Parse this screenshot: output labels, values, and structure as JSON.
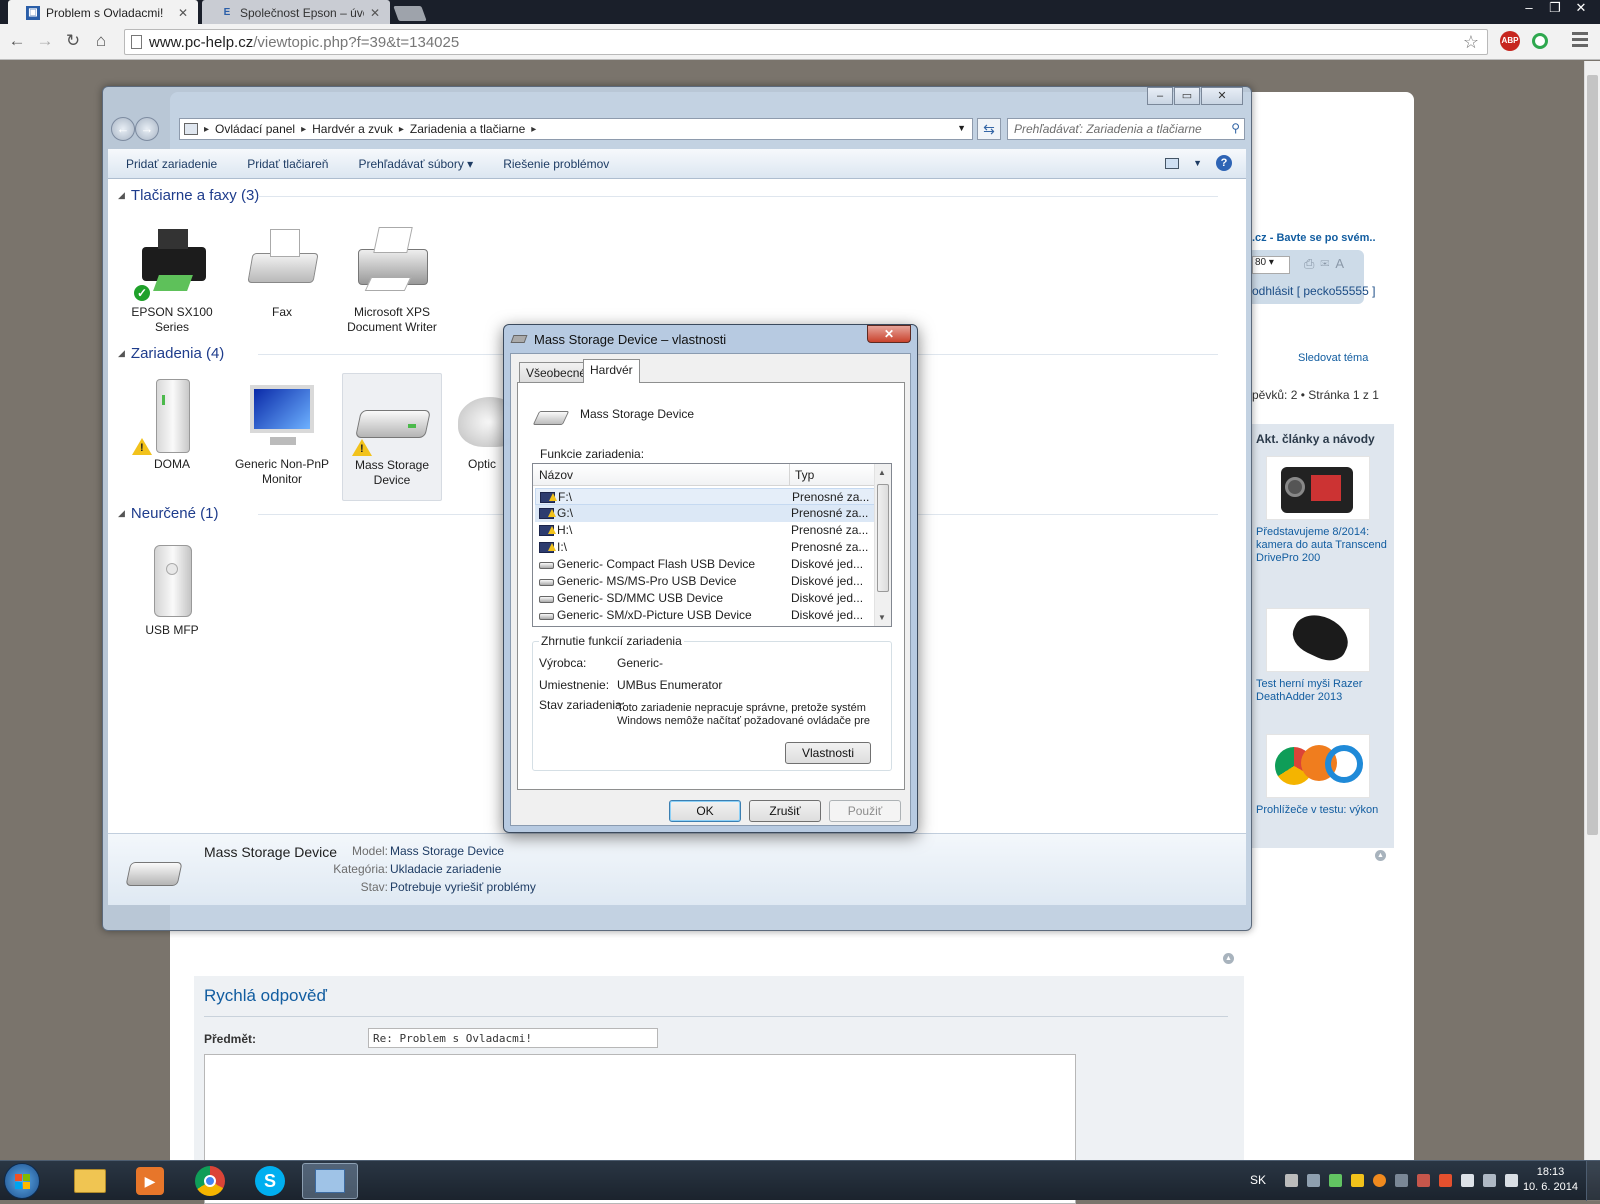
{
  "browser": {
    "tabs": [
      {
        "label": "Problem s Ovladacmi!",
        "active": true
      },
      {
        "label": "Společnost Epson – úvodní",
        "active": false
      }
    ],
    "url_host": "www.pc-help.cz",
    "url_path": "/viewtopic.php?f=39&t=134025",
    "extensions": [
      "ABP",
      "green-circle"
    ]
  },
  "page": {
    "right_column": {
      "topic_title": ".cz - Bavte se po svém..",
      "select_value": "80",
      "login_text": "odhlásit [ pecko55555 ]",
      "follow_label": "Sledovat téma",
      "pages_text": "pěvků: 2 • Stránka 1 z 1",
      "articles_header": "Akt. články a návody",
      "articles": [
        {
          "title": "Představujeme 8/2014: kamera do auta Transcend DrivePro 200"
        },
        {
          "title": "Test herní myši Razer DeathAdder 2013"
        },
        {
          "title": "Prohlížeče v testu: výkon"
        }
      ]
    },
    "quick_reply": {
      "title": "Rychlá odpověď",
      "subject_label": "Předmět:",
      "subject_value": "Re: Problem s Ovladacmi!"
    }
  },
  "explorer": {
    "breadcrumbs": [
      "Ovládací panel",
      "Hardvér a zvuk",
      "Zariadenia a tlačiarne"
    ],
    "search_placeholder": "Prehľadávať: Zariadenia a tlačiarne",
    "commands": [
      "Pridať zariadenie",
      "Pridať tlačiareň",
      "Prehľadávať súbory",
      "Riešenie problémov"
    ],
    "groups": [
      {
        "title": "Tlačiarne a faxy (3)",
        "devices": [
          {
            "label": "EPSON SX100 Series",
            "icon": "printer-icon",
            "badge": "default"
          },
          {
            "label": "Fax",
            "icon": "fax-icon",
            "badge": ""
          },
          {
            "label": "Microsoft XPS Document Writer",
            "icon": "printer-icon",
            "badge": ""
          }
        ]
      },
      {
        "title": "Zariadenia (4)",
        "devices": [
          {
            "label": "DOMA",
            "icon": "computer-tower-icon",
            "badge": "warning"
          },
          {
            "label": "Generic Non-PnP Monitor",
            "icon": "monitor-icon",
            "badge": ""
          },
          {
            "label": "Mass Storage Device",
            "icon": "drive-icon",
            "badge": "warning"
          },
          {
            "label": "Optic",
            "icon": "mouse-icon",
            "badge": ""
          }
        ]
      },
      {
        "title": "Neurčené (1)",
        "devices": [
          {
            "label": "USB MFP",
            "icon": "computer-tower-icon",
            "badge": ""
          }
        ]
      }
    ],
    "details": {
      "name": "Mass Storage Device",
      "model_label": "Model:",
      "model_value": "Mass Storage Device",
      "category_label": "Kategória:",
      "category_value": "Ukladacie zariadenie",
      "state_label": "Stav:",
      "state_value": "Potrebuje vyriešiť problémy"
    }
  },
  "dialog": {
    "title": "Mass Storage Device – vlastnosti",
    "tabs": [
      "Všeobecné",
      "Hardvér"
    ],
    "device_name": "Mass Storage Device",
    "functions_label": "Funkcie zariadenia:",
    "columns": [
      "Názov",
      "Typ"
    ],
    "rows": [
      {
        "name": "F:\\",
        "type": "Prenosné za...",
        "icon": "volume"
      },
      {
        "name": "G:\\",
        "type": "Prenosné za...",
        "icon": "volume"
      },
      {
        "name": "H:\\",
        "type": "Prenosné za...",
        "icon": "volume"
      },
      {
        "name": "I:\\",
        "type": "Prenosné za...",
        "icon": "volume"
      },
      {
        "name": "Generic- Compact Flash USB Device",
        "type": "Diskové jed...",
        "icon": "disk"
      },
      {
        "name": "Generic- MS/MS-Pro USB Device",
        "type": "Diskové jed...",
        "icon": "disk"
      },
      {
        "name": "Generic- SD/MMC USB Device",
        "type": "Diskové jed...",
        "icon": "disk"
      },
      {
        "name": "Generic- SM/xD-Picture USB Device",
        "type": "Diskové jed...",
        "icon": "disk"
      }
    ],
    "summary": {
      "legend": "Zhrnutie funkcií zariadenia",
      "manufacturer_label": "Výrobca:",
      "manufacturer_value": "Generic-",
      "location_label": "Umiestnenie:",
      "location_value": "UMBus Enumerator",
      "status_label": "Stav zariadenia:",
      "status_value": "Toto zariadenie nepracuje správne, pretože systém Windows nemôže načítať požadované ovládače pre",
      "properties_button": "Vlastnosti"
    },
    "buttons": {
      "ok": "OK",
      "cancel": "Zrušiť",
      "apply": "Použiť"
    }
  },
  "taskbar": {
    "language": "SK",
    "time": "18:13",
    "date": "10. 6. 2014"
  }
}
